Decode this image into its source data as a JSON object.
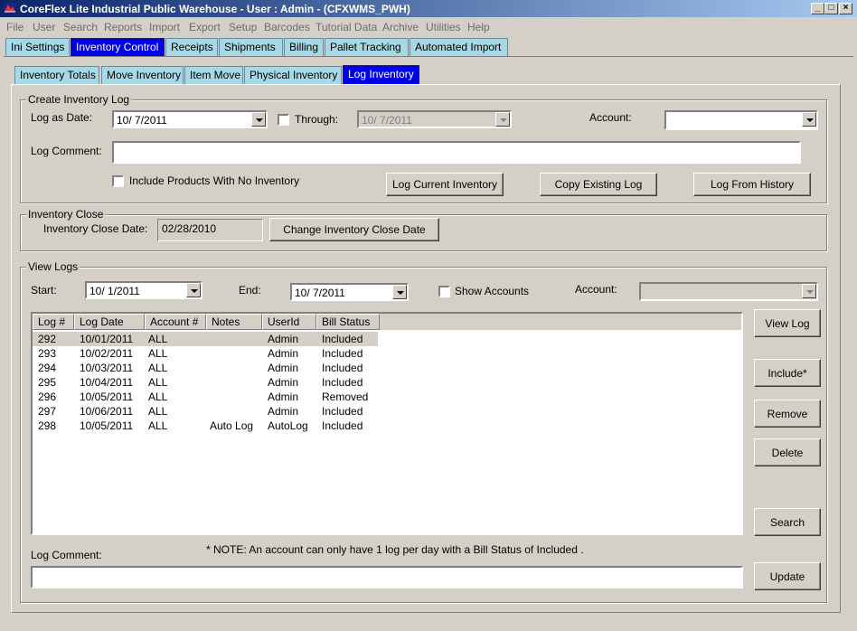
{
  "window": {
    "title": "CoreFlex Lite Industrial Public Warehouse - User : Admin - (CFXWMS_PWH)",
    "minimize": "_",
    "maximize": "□",
    "close": "×"
  },
  "menu": [
    "File",
    "User",
    "Search",
    "Reports",
    "Import",
    "Export",
    "Setup",
    "Barcodes",
    "Tutorial Data",
    "Archive",
    "Utilities",
    "Help"
  ],
  "main_tabs": [
    "Ini Settings",
    "Inventory Control",
    "Receipts",
    "Shipments",
    "Billing",
    "Pallet Tracking",
    "Automated Import"
  ],
  "sub_tabs": [
    "Inventory Totals",
    "Move Inventory",
    "Item Move",
    "Physical Inventory",
    "Log Inventory"
  ],
  "create_log": {
    "group_label": "Create Inventory Log",
    "log_as_date_label": "Log as Date:",
    "log_as_date_value": "10/  7/2011",
    "through_label": "Through:",
    "through_value": "10/  7/2011",
    "account_label": "Account:",
    "account_value": "",
    "comment_label": "Log Comment:",
    "comment_value": "",
    "include_no_inventory_label": "Include Products With No Inventory",
    "log_current_button": "Log Current Inventory",
    "copy_existing_button": "Copy Existing Log",
    "log_from_history_button": "Log From History"
  },
  "inventory_close": {
    "group_label": "Inventory Close",
    "date_label": "Inventory Close Date:",
    "date_value": "02/28/2010",
    "change_button": "Change Inventory Close Date"
  },
  "view_logs": {
    "group_label": "View Logs",
    "start_label": "Start:",
    "start_value": "10/  1/2011",
    "end_label": "End:",
    "end_value": "10/  7/2011",
    "show_accounts_label": "Show Accounts",
    "account_label": "Account:",
    "account_value": "",
    "columns": [
      "Log #",
      "Log Date",
      "Account #",
      "Notes",
      "UserId",
      "Bill Status"
    ],
    "rows": [
      {
        "log": "292",
        "date": "10/01/2011",
        "account": "ALL",
        "notes": "",
        "user": "Admin",
        "status": "Included"
      },
      {
        "log": "293",
        "date": "10/02/2011",
        "account": "ALL",
        "notes": "",
        "user": "Admin",
        "status": "Included"
      },
      {
        "log": "294",
        "date": "10/03/2011",
        "account": "ALL",
        "notes": "",
        "user": "Admin",
        "status": "Included"
      },
      {
        "log": "295",
        "date": "10/04/2011",
        "account": "ALL",
        "notes": "",
        "user": "Admin",
        "status": "Included"
      },
      {
        "log": "296",
        "date": "10/05/2011",
        "account": "ALL",
        "notes": "",
        "user": "Admin",
        "status": "Removed"
      },
      {
        "log": "297",
        "date": "10/06/2011",
        "account": "ALL",
        "notes": "",
        "user": "Admin",
        "status": "Included"
      },
      {
        "log": "298",
        "date": "10/05/2011",
        "account": "ALL",
        "notes": "Auto Log",
        "user": "AutoLog",
        "status": "Included"
      }
    ],
    "note": "*  NOTE: An account can only have 1 log per day with a Bill Status of Included .",
    "comment_label": "Log Comment:",
    "comment_value": "",
    "buttons": {
      "view_log": "View Log",
      "include": "Include*",
      "remove": "Remove",
      "delete": "Delete",
      "search": "Search",
      "update": "Update"
    }
  },
  "colors": {
    "titlebar_start": "#0a246a",
    "titlebar_end": "#a6caf0",
    "tab_bg": "#a6d8e6",
    "tab_active": "#0000e8",
    "face": "#d4d0c8"
  }
}
